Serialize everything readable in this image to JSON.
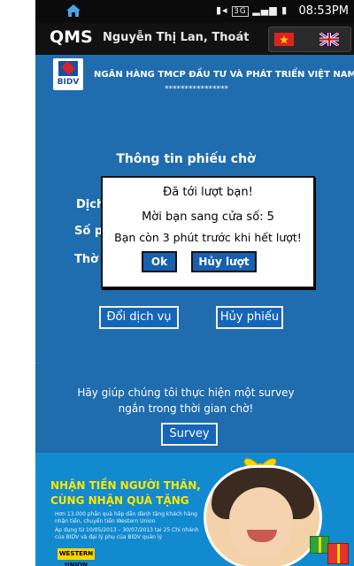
{
  "status_bar": {
    "home_icon": "home-icon",
    "network": "3G",
    "time": "08:53PM"
  },
  "app_bar": {
    "logo": "QMS",
    "user_name": "Nguyễn Thị Lan, Thoát",
    "flags": [
      "vietnam-flag-icon",
      "uk-flag-icon"
    ]
  },
  "bank": {
    "logo_text": "BIDV",
    "name": "NGÂN HÀNG TMCP ĐẦU TƯ VÀ PHÁT TRIỂN VIỆT NAM",
    "stars": "****************"
  },
  "ticket": {
    "title": "Thông tin phiếu chờ",
    "label_fragments": [
      "Dịch",
      "Số p",
      "Thờ"
    ]
  },
  "dialog": {
    "line1": "Đã tới lượt bạn!",
    "line2": "Mời bạn sang cửa số: 5",
    "line3": "Bạn còn 3 phút trước khi hết lượt!",
    "ok_label": "Ok",
    "cancel_label": "Hủy lượt"
  },
  "actions": {
    "change_service_label": "Đổi dịch vụ",
    "cancel_ticket_label": "Hủy phiếu"
  },
  "survey": {
    "text_line1": "Hãy giúp chúng tôi thực hiện một survey",
    "text_line2": "ngắn trong thời gian chờ!",
    "button_label": "Survey"
  },
  "banner": {
    "headline_line1": "NHẬN TIỀN NGƯỜI THÂN,",
    "headline_line2": "CÙNG NHẬN QUÀ TẶNG",
    "bullet1": "Hơn 13.000 phần quà hấp dẫn dành tặng khách hàng nhận tiền, chuyển tiền Western Union",
    "bullet2": "Áp dụng từ 10/05/2013 – 30/07/2013 tại 25 Chi nhánh của BIDV và đại lý phụ của BIDV quản lý",
    "brand": "WESTERN UNION"
  },
  "colors": {
    "screen_bg": "#1f6cae",
    "appbar_bg": "#111111",
    "banner_bg": "#128ad0",
    "headline_yellow": "#ffe600",
    "button_blue": "#1565b8"
  }
}
